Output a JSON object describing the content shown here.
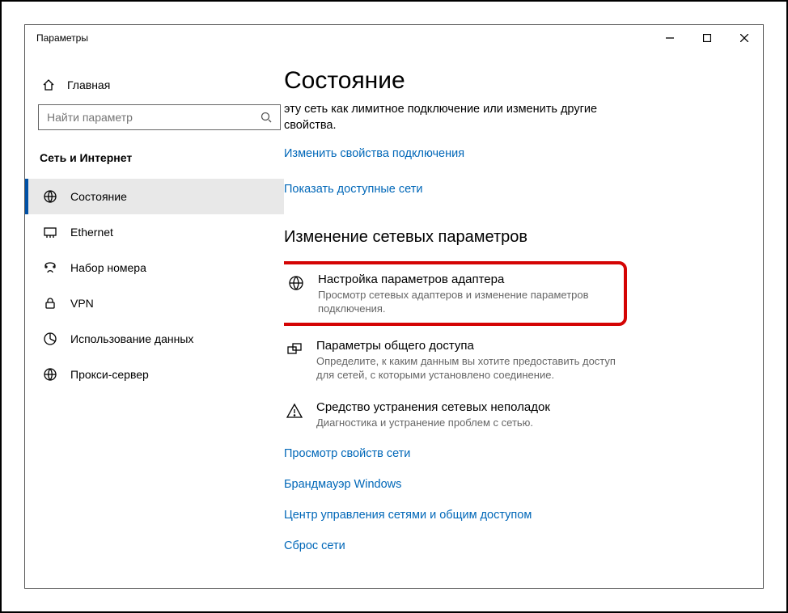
{
  "window": {
    "title": "Параметры"
  },
  "sidebar": {
    "home": "Главная",
    "search_placeholder": "Найти параметр",
    "section_label": "Сеть и Интернет",
    "items": [
      {
        "label": "Состояние"
      },
      {
        "label": "Ethernet"
      },
      {
        "label": "Набор номера"
      },
      {
        "label": "VPN"
      },
      {
        "label": "Использование данных"
      },
      {
        "label": "Прокси-сервер"
      }
    ]
  },
  "content": {
    "title": "Состояние",
    "intro": "эту сеть как лимитное подключение или изменить другие свойства.",
    "link_change_props": "Изменить свойства подключения",
    "link_show_networks": "Показать доступные сети",
    "subheader": "Изменение сетевых параметров",
    "adapter": {
      "title": "Настройка параметров адаптера",
      "desc": "Просмотр сетевых адаптеров и изменение параметров подключения."
    },
    "sharing": {
      "title": "Параметры общего доступа",
      "desc": "Определите, к каким данным вы хотите предоставить доступ для сетей, с которыми установлено соединение."
    },
    "troubleshoot": {
      "title": "Средство устранения сетевых неполадок",
      "desc": "Диагностика и устранение проблем с сетью."
    },
    "link_view_props": "Просмотр свойств сети",
    "link_firewall": "Брандмауэр Windows",
    "link_sharing_center": "Центр управления сетями и общим доступом",
    "link_reset": "Сброс сети"
  }
}
